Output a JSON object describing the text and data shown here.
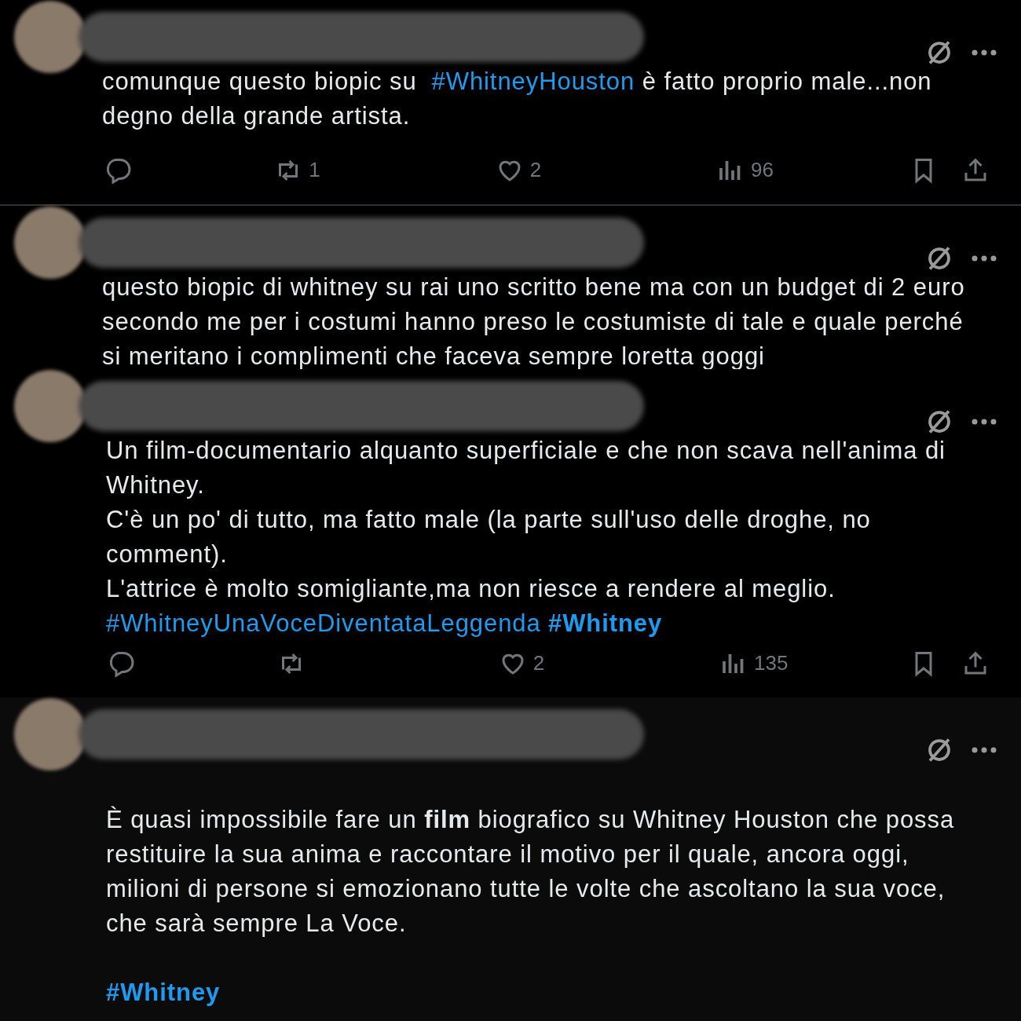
{
  "tweets": [
    {
      "paragraphs": [
        [
          [
            {
              "kind": "plain",
              "text": "comunque questo biopic su "
            },
            {
              "kind": "hashtag",
              "text": "#WhitneyHouston"
            },
            {
              "kind": "plain",
              "text": " è fatto proprio male...non"
            }
          ],
          [
            {
              "kind": "plain",
              "text": "degno della grande artista."
            }
          ]
        ]
      ],
      "actions": [
        {
          "kind": "reply"
        },
        {
          "kind": "retweet",
          "count": "1"
        },
        {
          "kind": "like",
          "count": "2"
        },
        {
          "kind": "views",
          "count": "96"
        },
        {
          "kind": "bookmark"
        },
        {
          "kind": "share"
        }
      ]
    },
    {
      "paragraphs": [
        [
          [
            {
              "kind": "plain",
              "text": "questo biopic di whitney su rai uno scritto bene ma con un budget di 2 euro"
            }
          ],
          [
            {
              "kind": "plain",
              "text": "secondo me per i costumi hanno preso le costumiste di tale e quale perché"
            }
          ],
          [
            {
              "kind": "plain",
              "text": "si meritano i complimenti che faceva sempre loretta goggi"
            }
          ]
        ]
      ]
    },
    {
      "paragraphs": [
        [
          [
            {
              "kind": "plain",
              "text": "Un film-documentario alquanto superficiale e che non scava nell'anima di"
            }
          ],
          [
            {
              "kind": "plain",
              "text": "Whitney."
            }
          ],
          [
            {
              "kind": "plain",
              "text": "C'è un po' di tutto, ma fatto male (la parte sull'uso delle droghe, no"
            }
          ],
          [
            {
              "kind": "plain",
              "text": "comment)."
            }
          ],
          [
            {
              "kind": "plain",
              "text": "L'attrice è molto somigliante,ma non riesce a rendere al meglio."
            }
          ],
          [
            {
              "kind": "hashtag",
              "text": "#WhitneyUnaVoceDiventataLeggenda"
            },
            {
              "kind": "bold_hashtag",
              "text": "#Whitney"
            }
          ]
        ]
      ],
      "actions": [
        {
          "kind": "reply"
        },
        {
          "kind": "retweet"
        },
        {
          "kind": "like",
          "count": "2"
        },
        {
          "kind": "views",
          "count": "135"
        },
        {
          "kind": "bookmark"
        },
        {
          "kind": "share"
        }
      ]
    },
    {
      "paragraphs": [
        [
          [
            {
              "kind": "plain",
              "text": "È quasi impossibile fare un "
            },
            {
              "kind": "bold",
              "text": "film"
            },
            {
              "kind": "plain",
              "text": " biografico su Whitney Houston che possa"
            }
          ],
          [
            {
              "kind": "plain",
              "text": "restituire la sua anima e raccontare il motivo per il quale, ancora oggi,"
            }
          ],
          [
            {
              "kind": "plain",
              "text": "milioni di persone si emozionano tutte le volte che ascoltano la sua voce,"
            }
          ],
          [
            {
              "kind": "plain",
              "text": "che sarà sempre La Voce."
            }
          ]
        ],
        [
          [
            {
              "kind": "bold_hashtag",
              "text": "#Whitney"
            }
          ]
        ]
      ]
    }
  ]
}
